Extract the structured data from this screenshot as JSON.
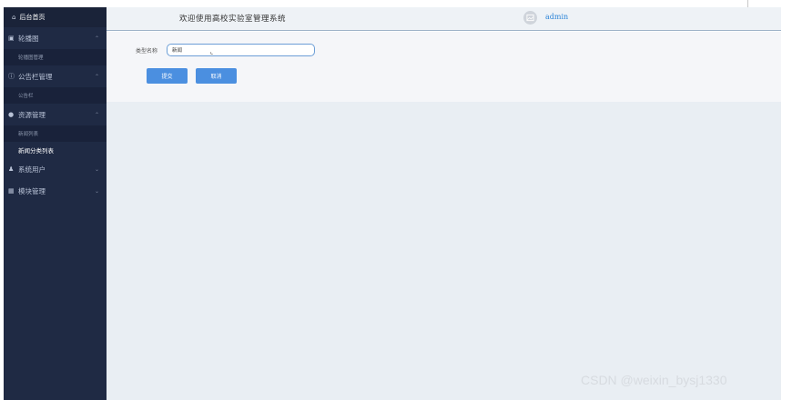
{
  "sidebar": {
    "home": {
      "label": "后台首页",
      "icon": "home-icon"
    },
    "groups": [
      {
        "label": "轮播图",
        "icon": "image-icon",
        "arrow": "^",
        "subs": [
          {
            "label": "轮播图管理",
            "active": false
          }
        ]
      },
      {
        "label": "公告栏管理",
        "icon": "info-circle-icon",
        "arrow": "^",
        "subs": [
          {
            "label": "公告栏",
            "active": false
          }
        ]
      },
      {
        "label": "资源管理",
        "icon": "location-pin-icon",
        "arrow": "^",
        "subs": [
          {
            "label": "新闻列表",
            "active": false
          },
          {
            "label": "新闻分类列表",
            "active": true
          }
        ]
      },
      {
        "label": "系统用户",
        "icon": "user-icon",
        "arrow": "v",
        "subs": []
      },
      {
        "label": "模块管理",
        "icon": "grid-icon",
        "arrow": "v",
        "subs": []
      }
    ]
  },
  "header": {
    "title": "欢迎使用高校实验室管理系统",
    "username": "admin"
  },
  "form": {
    "label": "类型名称",
    "value": "新闻",
    "submit_label": "提交",
    "cancel_label": "取消"
  },
  "watermark": "CSDN @weixin_bysj1330",
  "colors": {
    "sidebar_bg": "#1f2a44",
    "accent": "#4b8fe0",
    "link": "#2f86d8"
  }
}
